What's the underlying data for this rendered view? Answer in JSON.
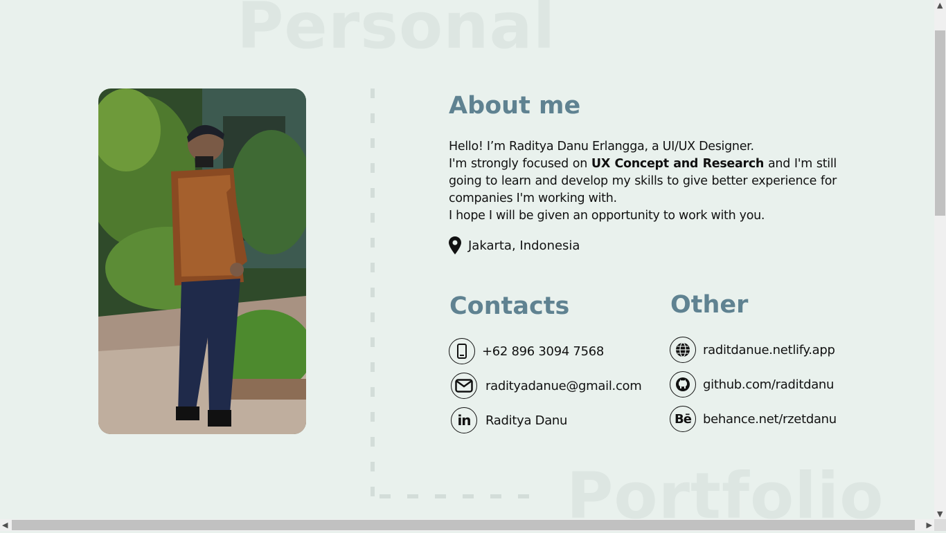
{
  "background_words": {
    "top": "Personal",
    "bottom": "Portfolio"
  },
  "about": {
    "title": "About me",
    "line1": "Hello! I’m Raditya Danu Erlangga, a UI/UX Designer.",
    "line2_pre": "I'm strongly focused on ",
    "line2_bold": "UX Concept and Research",
    "line2_post": " and I'm still going to learn and develop my skills to give better experience for companies I'm working with.",
    "line3": "I hope I will be given an opportunity to work with you.",
    "location": "Jakarta, Indonesia"
  },
  "contacts": {
    "title": "Contacts",
    "phone": "+62 896 3094 7568",
    "email": "radityadanue@gmail.com",
    "linkedin": "Raditya Danu"
  },
  "other": {
    "title": "Other",
    "website": "raditdanue.netlify.app",
    "github": "github.com/raditdanu",
    "behance": "behance.net/rzetdanu",
    "behance_glyph": "Bē"
  },
  "linkedin_glyph": "in",
  "colors": {
    "accent": "#5f8291",
    "background": "#e9f1ed",
    "watermark": "#dde6e2"
  },
  "icons": [
    "map-pin-icon",
    "phone-icon",
    "mail-icon",
    "linkedin-icon",
    "globe-icon",
    "github-icon",
    "behance-icon"
  ]
}
